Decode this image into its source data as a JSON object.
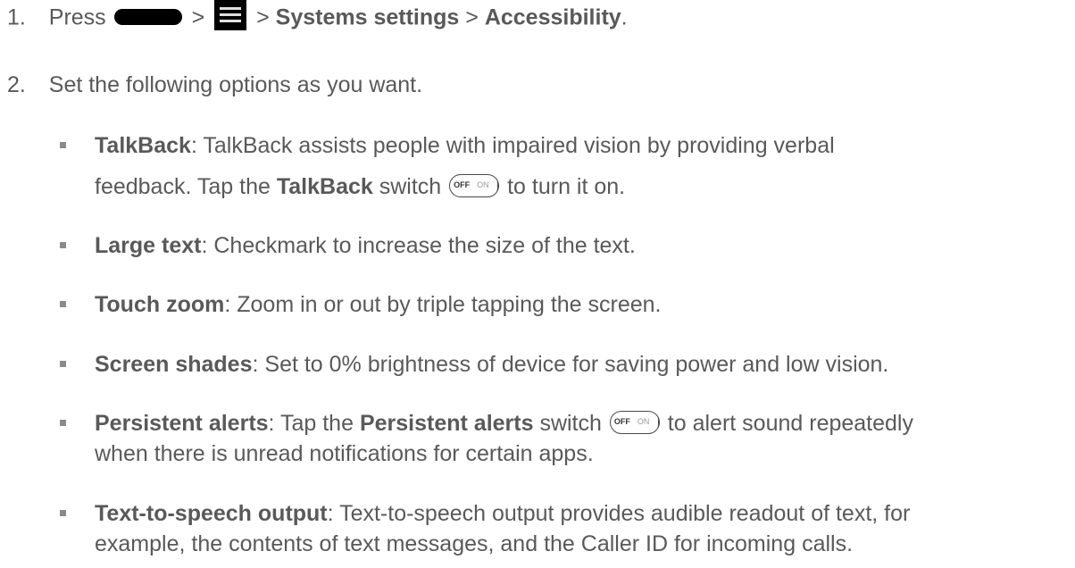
{
  "step1": {
    "number": "1.",
    "press": "Press",
    "gt1": ">",
    "gt2": ">",
    "systems_settings": "Systems settings",
    "gt3": ">",
    "accessibility": "Accessibility",
    "end": "."
  },
  "step2": {
    "number": "2.",
    "text": "Set the following options as you want."
  },
  "options": {
    "talkback": {
      "title": "TalkBack",
      "text1": ": TalkBack assists people with impaired vision by providing verbal",
      "text2a": "feedback. Tap the ",
      "switch_name": "TalkBack",
      "text2b": " switch ",
      "text2c": " to turn it on."
    },
    "large_text": {
      "title": "Large text",
      "text": ": Checkmark to increase the size of the text."
    },
    "touch_zoom": {
      "title": "Touch zoom",
      "text": ": Zoom in or out by triple tapping the screen."
    },
    "screen_shades": {
      "title": "Screen shades",
      "text": ": Set to 0% brightness of device for saving power and low vision."
    },
    "persistent_alerts": {
      "title": "Persistent alerts",
      "text1a": ": Tap the ",
      "switch_name": "Persistent alerts",
      "text1b": " switch ",
      "text1c": " to alert sound repeatedly",
      "text2": "when there is unread notifications for certain apps."
    },
    "tts": {
      "title": "Text-to-speech output",
      "text1": ": Text-to-speech output provides audible readout of text, for",
      "text2": "example, the contents of text messages, and the Caller ID for incoming calls."
    }
  },
  "switch": {
    "off": "OFF",
    "on": "ON"
  },
  "icons": {
    "home_key": "home-key-icon",
    "menu_key": "menu-key-icon",
    "switch": "off-on-switch-icon"
  }
}
